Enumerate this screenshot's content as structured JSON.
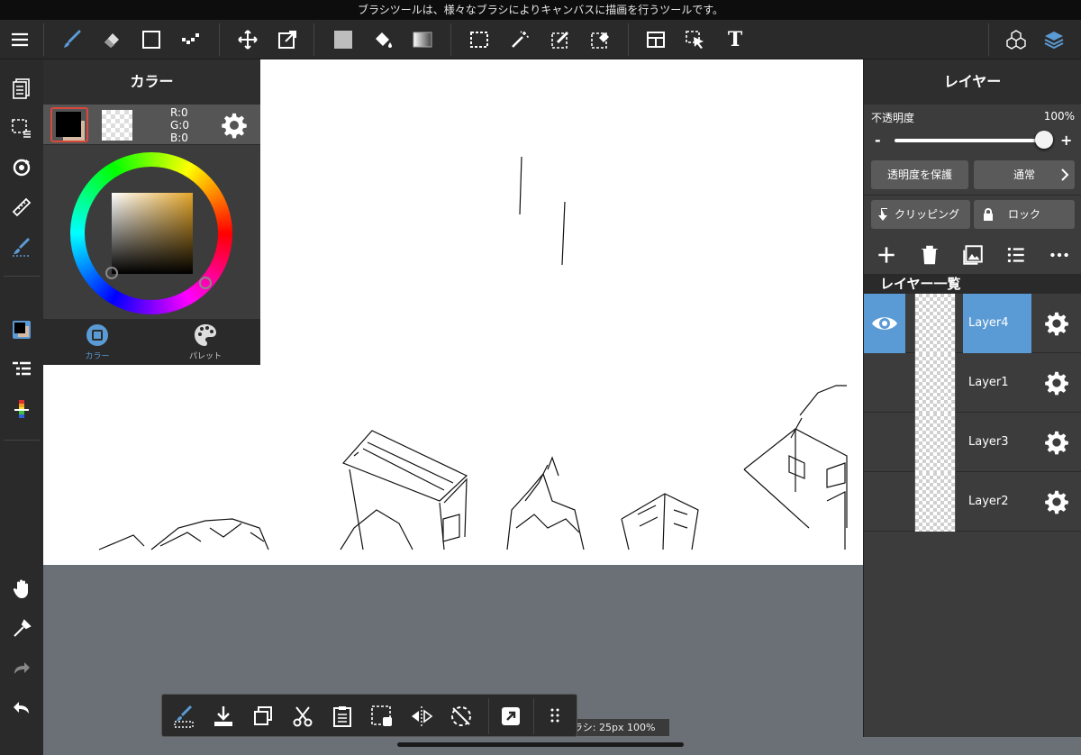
{
  "tooltip": "ブラシツールは、様々なブラシによりキャンバスに描画を行うツールです。",
  "toolbar": {
    "icons": [
      "menu-icon",
      "brush-icon",
      "eraser-icon",
      "shape-icon",
      "dot-icon",
      "move-icon",
      "transform-icon",
      "fill-rect-icon",
      "bucket-icon",
      "gradient-icon",
      "select-rect-icon",
      "magic-wand-icon",
      "select-pen-icon",
      "select-eraser-icon",
      "layout-icon",
      "pointer-icon",
      "text-icon",
      "3d-icon",
      "layers-icon"
    ],
    "text_label": "T"
  },
  "color_panel": {
    "title": "カラー",
    "r": "R:0",
    "g": "G:0",
    "b": "B:0",
    "tab_color": "カラー",
    "tab_palette": "パレット",
    "accent": "#5b9bd5"
  },
  "layer_panel": {
    "title": "レイヤー",
    "opacity_label": "不透明度",
    "opacity_value": "100%",
    "opacity": 1.0,
    "minus": "-",
    "plus": "+",
    "protect_alpha": "透明度を保護",
    "blend_mode": "通常",
    "clipping": "クリッピング",
    "lock": "ロック",
    "list_title": "レイヤー一覧",
    "layers": [
      {
        "name": "Layer4",
        "selected": true,
        "visible": true
      },
      {
        "name": "Layer1",
        "selected": false,
        "visible": false
      },
      {
        "name": "Layer3",
        "selected": false,
        "visible": false
      },
      {
        "name": "Layer2",
        "selected": false,
        "visible": false
      }
    ]
  },
  "status": {
    "brush_info": "ラシ: 25px 100%"
  }
}
